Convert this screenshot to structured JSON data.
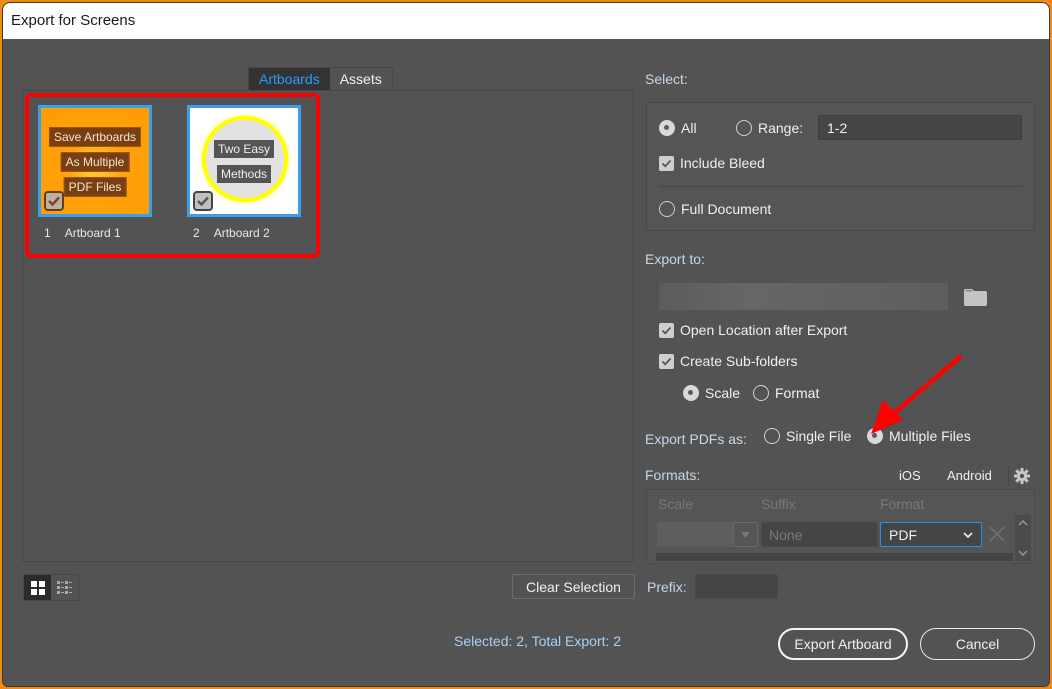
{
  "window": {
    "title": "Export for Screens"
  },
  "tabs": [
    {
      "label": "Artboards",
      "active": true
    },
    {
      "label": "Assets",
      "active": false
    }
  ],
  "artboards": [
    {
      "number": "1",
      "name": "Artboard 1",
      "checked": true,
      "thumbnail_lines": [
        "Save Artboards",
        "As Multiple",
        "PDF Files"
      ],
      "thumbnail_color": "#ff9c00"
    },
    {
      "number": "2",
      "name": "Artboard 2",
      "checked": true,
      "thumbnail_lines": [
        "Two Easy",
        "Methods"
      ],
      "thumbnail_color": "#ffffff"
    }
  ],
  "view_toggle": {
    "grid_icon": "grid-view-icon",
    "list_icon": "list-view-icon",
    "active": "grid"
  },
  "clear_selection_label": "Clear Selection",
  "status_text": "Selected: 2, Total Export: 2",
  "select": {
    "label": "Select:",
    "all_label": "All",
    "range_label": "Range:",
    "range_value": "1-2",
    "selected_option": "All",
    "include_bleed_label": "Include Bleed",
    "include_bleed_checked": true,
    "full_document_label": "Full Document"
  },
  "export_to": {
    "label": "Export to:",
    "path": "",
    "folder_icon": "folder-icon",
    "open_location_label": "Open Location after Export",
    "open_location_checked": true,
    "create_subfolders_label": "Create Sub-folders",
    "create_subfolders_checked": true,
    "subfolder_scale_label": "Scale",
    "subfolder_format_label": "Format",
    "subfolder_selected": "Scale"
  },
  "export_pdfs": {
    "label": "Export PDFs as:",
    "single_label": "Single File",
    "multiple_label": "Multiple Files",
    "selected": "Multiple Files"
  },
  "formats": {
    "label": "Formats:",
    "ios_label": "iOS",
    "android_label": "Android",
    "columns": [
      "Scale",
      "Suffix",
      "Format"
    ],
    "rows": [
      {
        "scale": "",
        "suffix_placeholder": "None",
        "format": "PDF"
      }
    ]
  },
  "prefix": {
    "label": "Prefix:",
    "value": ""
  },
  "buttons": {
    "export": "Export Artboard",
    "cancel": "Cancel"
  },
  "colors": {
    "accent": "#2d9bff",
    "annotation_red": "#ff0000",
    "dialog_bg": "#535353"
  }
}
